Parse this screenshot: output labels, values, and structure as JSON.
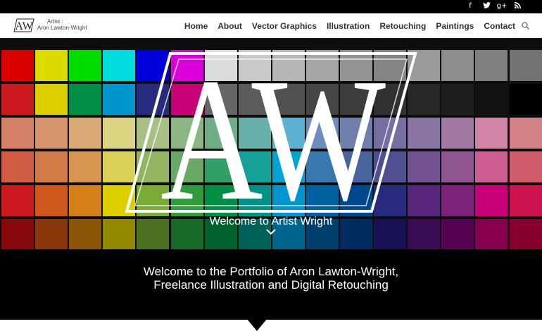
{
  "social": {
    "icons": [
      "facebook-icon",
      "twitter-icon",
      "google-plus-icon",
      "rss-icon"
    ],
    "facebook_glyph": "f",
    "googleplus_glyph": "g+"
  },
  "header": {
    "logo_monogram": "AW",
    "logo_line1": "Artist :",
    "logo_line2": "Aron Lawton-Wright"
  },
  "nav": {
    "items": [
      "Home",
      "About",
      "Vector Graphics",
      "Illustration",
      "Retouching",
      "Paintings",
      "Contact"
    ]
  },
  "hero": {
    "logo_monogram": "AW",
    "caption": "Welcome to Artist Wright",
    "swatch_rows": [
      [
        "#ff0000",
        "#ffff00",
        "#00ff00",
        "#00ffff",
        "#0000ff",
        "#ff00ff",
        "#ffffff",
        "#ebebeb",
        "#d6d6d6",
        "#c2c2c2",
        "#adadad",
        "#9a9a9a",
        "#b5b5b5",
        "#a5a5a5",
        "#959595",
        "#858585"
      ],
      [
        "#ed1c24",
        "#fff200",
        "#00a651",
        "#00aeef",
        "#2e3192",
        "#ec008c",
        "#777777",
        "#6a6a6a",
        "#5e5e5e",
        "#525252",
        "#464646",
        "#3a3a3a",
        "#2f2f2f",
        "#242424",
        "#151515",
        "#000000"
      ],
      [
        "#f69679",
        "#f9ad81",
        "#fdc689",
        "#fff799",
        "#c4df9b",
        "#a3d39c",
        "#82ca9c",
        "#7accc8",
        "#6dcff6",
        "#7da7d9",
        "#8393ca",
        "#8781bd",
        "#a187be",
        "#bd8cbf",
        "#f49ac1",
        "#f5989d"
      ],
      [
        "#f26c4f",
        "#f68e56",
        "#fbaf5d",
        "#fff467",
        "#acd373",
        "#7cc576",
        "#3bb878",
        "#1abbb4",
        "#00bff3",
        "#438ccb",
        "#5574b9",
        "#605ca8",
        "#8560a8",
        "#a864a8",
        "#f06eaa",
        "#f26d7d"
      ],
      [
        "#ed1c24",
        "#f26522",
        "#f7941d",
        "#fff200",
        "#8dc73f",
        "#39b54a",
        "#00a651",
        "#00a99d",
        "#00aeef",
        "#0072bc",
        "#0054a6",
        "#2e3192",
        "#662d91",
        "#92278f",
        "#ec008c",
        "#ed145b"
      ],
      [
        "#9e0b0f",
        "#a0410d",
        "#a36209",
        "#aba000",
        "#598527",
        "#1a7b30",
        "#007236",
        "#00746b",
        "#0076a3",
        "#004b80",
        "#003471",
        "#1b1464",
        "#440e62",
        "#630460",
        "#9e005d",
        "#9e0039"
      ]
    ]
  },
  "welcome": {
    "line1": "Welcome to the Portfolio of Aron Lawton-Wright,",
    "line2": "Freelance Illustration and Digital Retouching"
  }
}
